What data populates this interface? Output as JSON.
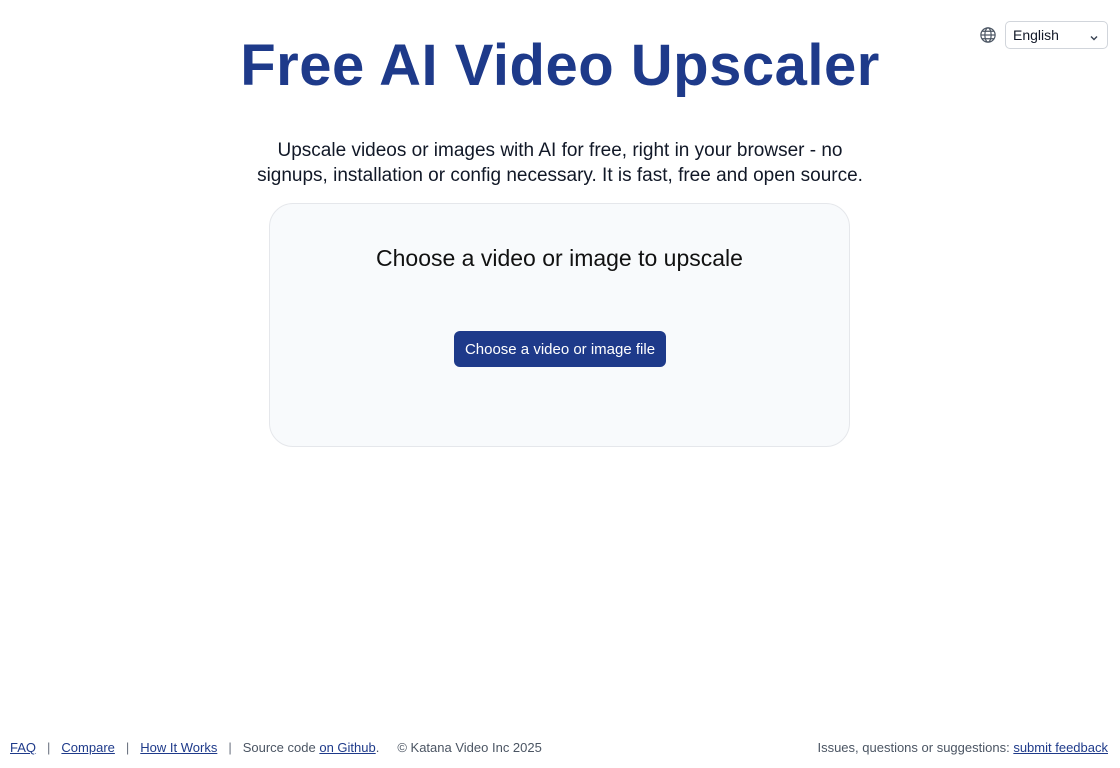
{
  "header": {
    "title": "Free AI Video Upscaler",
    "subtitle": "Upscale videos or images with AI for free, right in your browser - no signups, installation or config necessary. It is fast, free and open source."
  },
  "language": {
    "icon": "globe-icon",
    "selected": "English"
  },
  "upload": {
    "heading": "Choose a video or image to upscale",
    "button_label": "Choose a video or image file"
  },
  "footer": {
    "links": {
      "faq": "FAQ",
      "compare": "Compare",
      "how_it_works": "How It Works",
      "github": "on Github"
    },
    "separator": "|",
    "source_code_prefix": "Source code",
    "source_code_suffix": ".",
    "copyright": "© Katana Video Inc 2025",
    "feedback_prefix": "Issues, questions or suggestions:",
    "feedback_link": "submit feedback"
  },
  "colors": {
    "accent": "#1e3a8a",
    "card_bg": "#f8fafc"
  }
}
